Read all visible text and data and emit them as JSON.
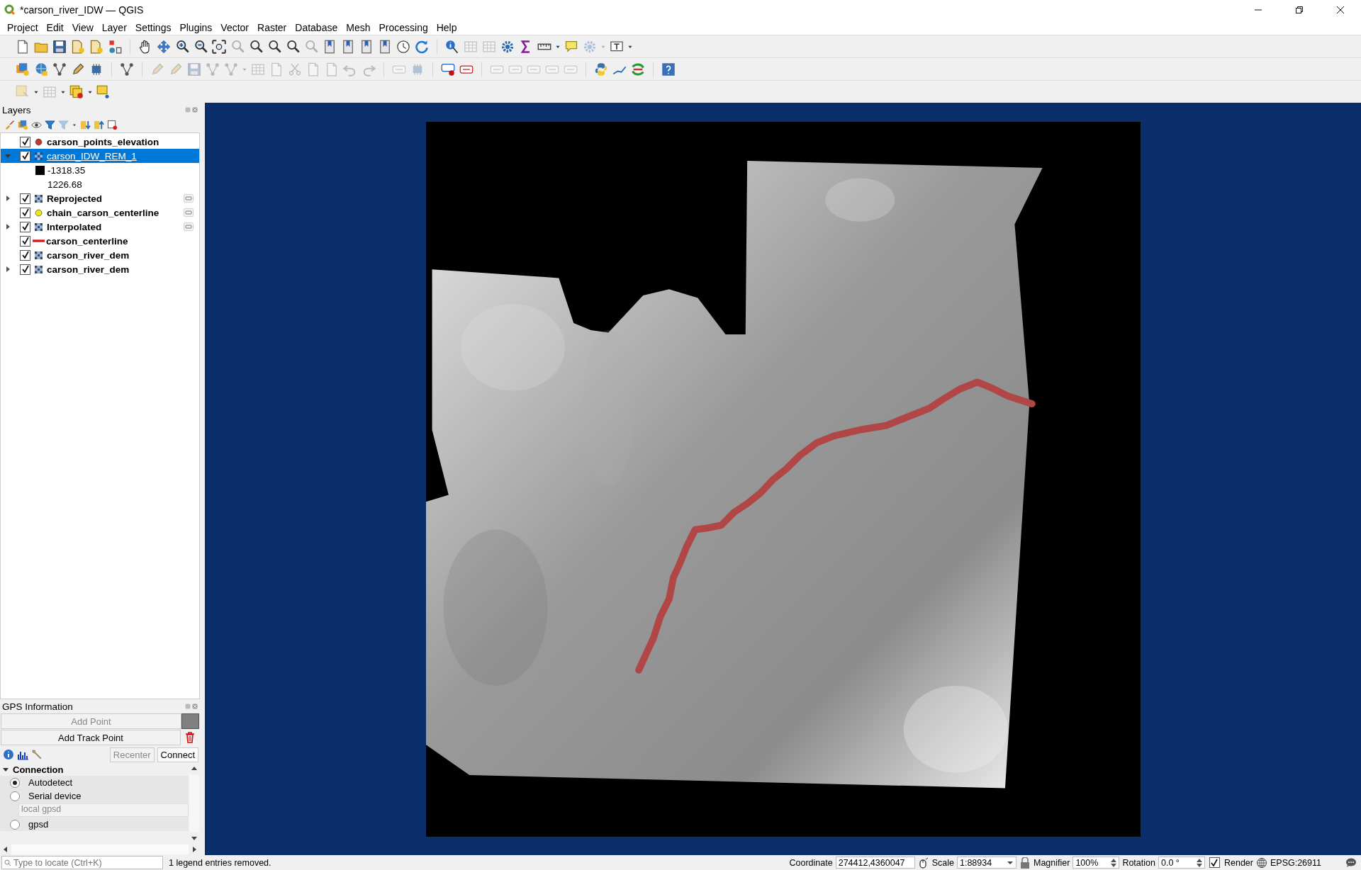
{
  "window": {
    "title": "*carson_river_IDW — QGIS"
  },
  "menu": [
    "Project",
    "Edit",
    "View",
    "Layer",
    "Settings",
    "Plugins",
    "Vector",
    "Raster",
    "Database",
    "Mesh",
    "Processing",
    "Help"
  ],
  "layers_panel": {
    "title": "Layers",
    "layers": [
      {
        "name": "carson_points_elevation",
        "checked": true,
        "selected": false,
        "kind": "point",
        "color": "#c0392b",
        "indicator": false
      },
      {
        "name": "carson_IDW_REM_1",
        "checked": true,
        "selected": true,
        "kind": "raster",
        "expanded": true,
        "indicator": false,
        "children": [
          {
            "label": "-1318.35",
            "color": "#000000"
          },
          {
            "label": "1226.68"
          }
        ]
      },
      {
        "name": "Reprojected",
        "checked": true,
        "selected": false,
        "kind": "raster",
        "expanded": false,
        "indicator": true
      },
      {
        "name": "chain_carson_centerline",
        "checked": true,
        "selected": false,
        "kind": "point",
        "color": "#f2e60c",
        "indicator": true
      },
      {
        "name": "Interpolated",
        "checked": true,
        "selected": false,
        "kind": "raster",
        "expanded": false,
        "indicator": true
      },
      {
        "name": "carson_centerline",
        "checked": true,
        "selected": false,
        "kind": "line",
        "color": "#d01c1c",
        "indicator": false
      },
      {
        "name": "carson_river_dem",
        "checked": true,
        "selected": false,
        "kind": "raster",
        "indicator": false
      },
      {
        "name": "carson_river_dem",
        "checked": true,
        "selected": false,
        "kind": "raster",
        "expanded": false,
        "indicator": false
      }
    ]
  },
  "gps_panel": {
    "title": "GPS Information",
    "buttons": [
      {
        "label": "Add Point",
        "disabled": true
      },
      {
        "label": "Add Track Point",
        "disabled": false
      }
    ],
    "recenter": {
      "label": "Recenter",
      "disabled": true
    },
    "connect": {
      "label": "Connect",
      "disabled": false
    },
    "section": {
      "title": "Connection",
      "expanded": true
    },
    "options": [
      {
        "kind": "radio",
        "label": "Autodetect",
        "selected": true
      },
      {
        "kind": "radio",
        "label": "Serial device",
        "selected": false
      },
      {
        "kind": "field",
        "value": "local gpsd",
        "disabled": true
      },
      {
        "kind": "radio",
        "label": "gpsd",
        "selected": false
      }
    ]
  },
  "status_bar": {
    "locate_placeholder": "Type to locate (Ctrl+K)",
    "message": "1 legend entries removed.",
    "coordinate_label": "Coordinate",
    "coordinate": "274412,4360047",
    "scale_label": "Scale",
    "scale": "1:88934",
    "magnifier_label": "Magnifier",
    "magnifier": "100%",
    "rotation_label": "Rotation",
    "rotation": "0.0 °",
    "render_label": "Render",
    "render": true,
    "crs": "EPSG:26911"
  }
}
